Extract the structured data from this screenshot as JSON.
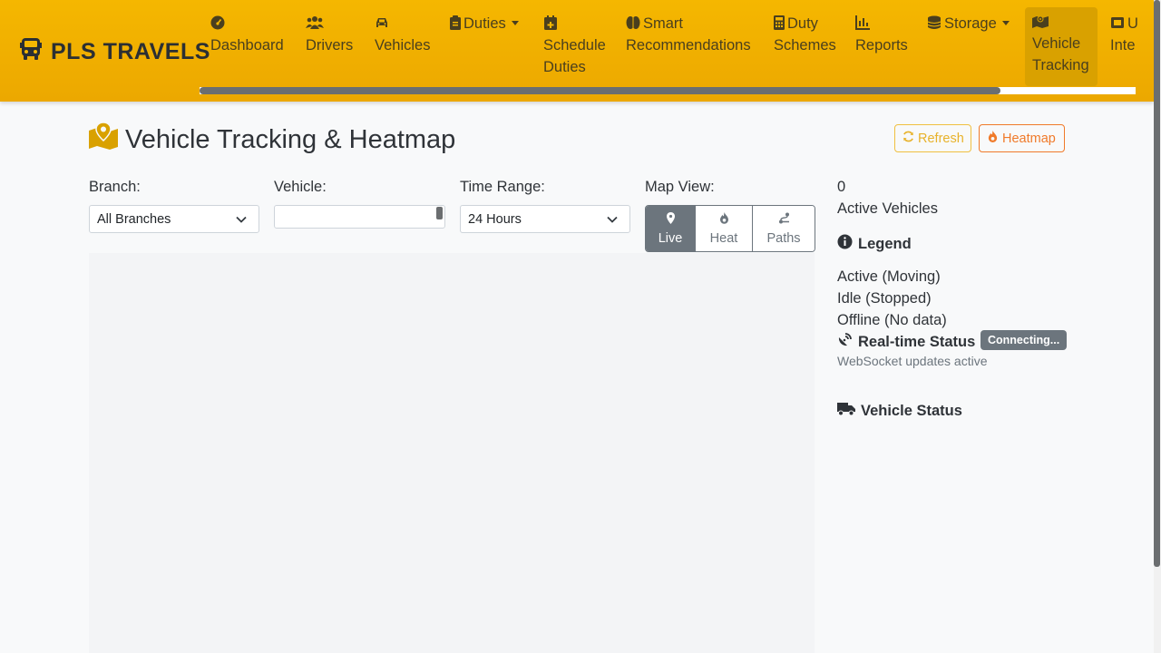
{
  "brand": {
    "name": "PLS TRAVELS",
    "icon": "bus-icon"
  },
  "nav": {
    "items": [
      {
        "label": "Dashboard",
        "icon": "tachometer-icon"
      },
      {
        "label": "Drivers",
        "icon": "users-icon"
      },
      {
        "label": "Vehicles",
        "icon": "car-icon"
      },
      {
        "label": "Duties",
        "icon": "clipboard-icon",
        "dropdown": true
      },
      {
        "label_l1": "Schedule",
        "label_l2": "Duties",
        "icon": "calendar-plus-icon"
      },
      {
        "label_l1": "Smart",
        "label_l2": "Recommendations",
        "icon": "brain-icon"
      },
      {
        "label_l1": "Duty",
        "label_l2": "Schemes",
        "icon": "calculator-icon"
      },
      {
        "label": "Reports",
        "icon": "chart-line-icon"
      },
      {
        "label": "Storage",
        "icon": "database-icon",
        "dropdown": true
      },
      {
        "label_l1": "Vehicle",
        "label_l2": "Tracking",
        "icon": "map-marked-icon",
        "active": true
      },
      {
        "label_l1": "U",
        "label_l2": "Inte",
        "icon": "id-card-icon"
      }
    ]
  },
  "page": {
    "title": "Vehicle Tracking & Heatmap",
    "title_icon": "map-location-icon",
    "refresh_label": "Refresh",
    "heatmap_label": "Heatmap"
  },
  "filters": {
    "branch_label": "Branch:",
    "branch_value": "All Branches",
    "vehicle_label": "Vehicle:",
    "vehicle_value": "",
    "time_label": "Time Range:",
    "time_value": "24 Hours",
    "mapview_label": "Map View:",
    "views": [
      {
        "label": "Live",
        "icon": "map-pin-icon",
        "active": true
      },
      {
        "label": "Heat",
        "icon": "fire-icon",
        "active": false
      },
      {
        "label": "Paths",
        "icon": "route-icon",
        "active": false
      }
    ]
  },
  "sidebar": {
    "active_count": "0",
    "active_label": "Active Vehicles",
    "legend_title": "Legend",
    "legend": [
      "Active (Moving)",
      "Idle (Stopped)",
      "Offline (No data)"
    ],
    "realtime_title": "Real-time Status",
    "realtime_badge": "Connecting...",
    "realtime_note": "WebSocket updates active",
    "vehicle_status_title": "Vehicle Status"
  },
  "colors": {
    "navbar": "#f5b700",
    "active_nav": "#d9a100",
    "heatmap_accent": "#f07a2a",
    "refresh_accent": "#e8b22a",
    "secondary": "#6c757d"
  }
}
